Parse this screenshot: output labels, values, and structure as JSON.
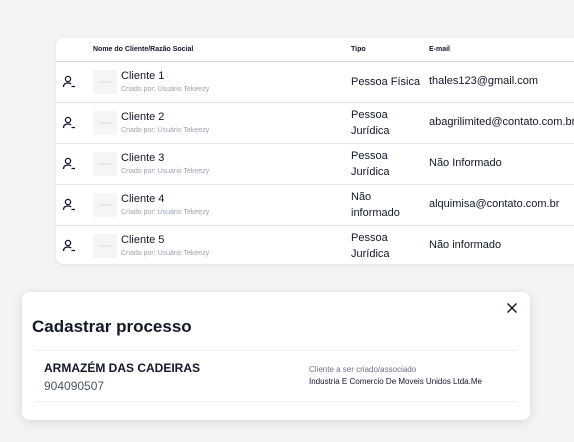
{
  "table": {
    "headers": {
      "name": "Nome do Cliente/Razão Social",
      "type": "Tipo",
      "email": "E-mail"
    },
    "rows": [
      {
        "name": "Cliente 1",
        "created_by": "Criado por: Usuário Tekeezy",
        "type": "Pessoa Física",
        "email": "thales123@gmail.com"
      },
      {
        "name": "Cliente 2",
        "created_by": "Criado por: Usuário Tekeezy",
        "type": "Pessoa Jurídica",
        "email": "abagrilimited@contato.com.br"
      },
      {
        "name": "Cliente 3",
        "created_by": "Criado por: Usuário Tekeezy",
        "type": "Pessoa Jurídica",
        "email": "Não Informado"
      },
      {
        "name": "Cliente 4",
        "created_by": "Criado por: Usuário Tekeezy",
        "type": "Não informado",
        "email": "alquimisa@contato.com.br"
      },
      {
        "name": "Cliente 5",
        "created_by": "Criado por: Usuário Tekeezy",
        "type": "Pessoa Jurídica",
        "email": "Não informado"
      }
    ]
  },
  "modal": {
    "title": "Cadastrar processo",
    "process_name": "ARMAZÉM DAS CADEIRAS",
    "process_code": "904090507",
    "assoc_label": "Cliente a ser criado/associado",
    "assoc_value": "Industria E Comercio De Moveis Unidos Ltda.Me"
  },
  "icons": {
    "row_icon": "user-icon",
    "close": "close-icon"
  },
  "colors": {
    "background": "#f3f4f6",
    "card": "#ffffff",
    "text": "#111827",
    "muted": "#9ca3af"
  }
}
